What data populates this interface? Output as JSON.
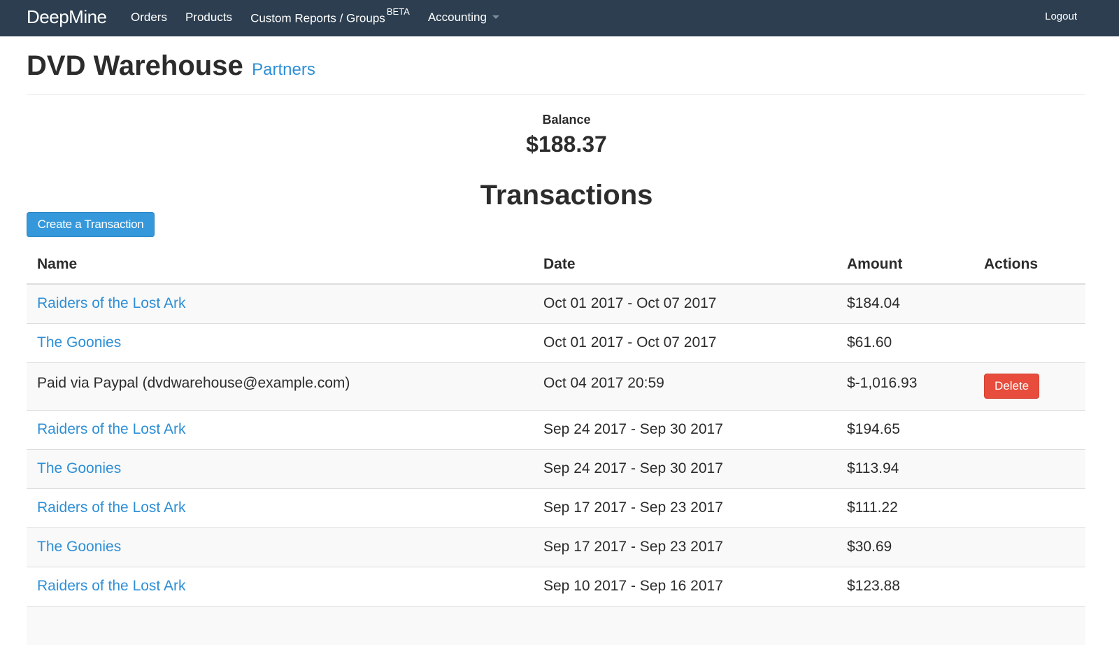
{
  "navbar": {
    "brand": "DeepMine",
    "items": [
      {
        "label": "Orders"
      },
      {
        "label": "Products"
      },
      {
        "label": "Custom Reports / Groups",
        "badge": "BETA"
      },
      {
        "label": "Accounting",
        "dropdown": true
      }
    ],
    "logout": "Logout"
  },
  "header": {
    "title": "DVD Warehouse",
    "subtitle": "Partners"
  },
  "balance": {
    "label": "Balance",
    "value": "$188.37"
  },
  "transactions": {
    "title": "Transactions",
    "create_button": "Create a Transaction",
    "columns": [
      "Name",
      "Date",
      "Amount",
      "Actions"
    ],
    "rows": [
      {
        "name": "Raiders of the Lost Ark",
        "link": true,
        "date": "Oct 01 2017 - Oct 07 2017",
        "amount": "$184.04",
        "action": ""
      },
      {
        "name": "The Goonies",
        "link": true,
        "date": "Oct 01 2017 - Oct 07 2017",
        "amount": "$61.60",
        "action": ""
      },
      {
        "name": "Paid via Paypal (dvdwarehouse@example.com)",
        "link": false,
        "date": "Oct 04 2017 20:59",
        "amount": "$-1,016.93",
        "action": "Delete"
      },
      {
        "name": "Raiders of the Lost Ark",
        "link": true,
        "date": "Sep 24 2017 - Sep 30 2017",
        "amount": "$194.65",
        "action": ""
      },
      {
        "name": "The Goonies",
        "link": true,
        "date": "Sep 24 2017 - Sep 30 2017",
        "amount": "$113.94",
        "action": ""
      },
      {
        "name": "Raiders of the Lost Ark",
        "link": true,
        "date": "Sep 17 2017 - Sep 23 2017",
        "amount": "$111.22",
        "action": ""
      },
      {
        "name": "The Goonies",
        "link": true,
        "date": "Sep 17 2017 - Sep 23 2017",
        "amount": "$30.69",
        "action": ""
      },
      {
        "name": "Raiders of the Lost Ark",
        "link": true,
        "date": "Sep 10 2017 - Sep 16 2017",
        "amount": "$123.88",
        "action": ""
      }
    ]
  },
  "colors": {
    "navbar_bg": "#2c3e50",
    "link": "#2e8fd6",
    "primary_button": "#3498db",
    "danger_button": "#e74c3c"
  }
}
